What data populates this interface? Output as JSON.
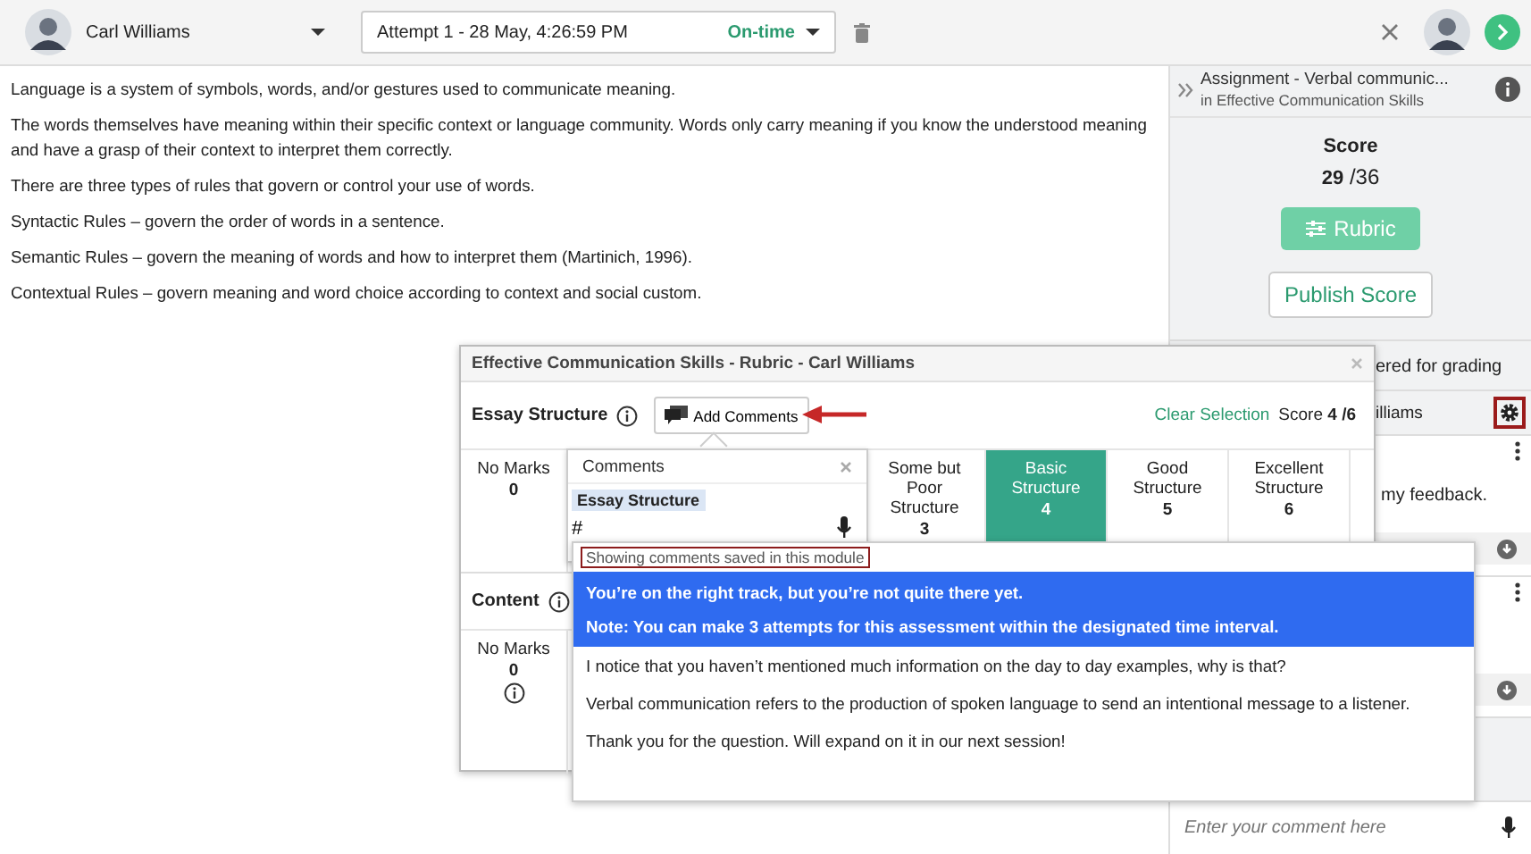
{
  "top_bar": {
    "student": "Carl Williams",
    "attempt": "Attempt 1 - 28 May, 4:26:59 PM",
    "status": "On-time"
  },
  "submission": {
    "paragraphs": [
      "Language is a system of symbols, words, and/or gestures used to communicate meaning.",
      "The words themselves have meaning within their specific context or language community. Words only carry meaning if you know the understood meaning and have a grasp of their context to interpret them correctly.",
      "There are three types of rules that govern or control your use of words.",
      "Syntactic Rules – govern the order of words in a sentence.",
      "Semantic Rules – govern the meaning of words and how to interpret them (Martinich, 1996).",
      "Contextual Rules – govern meaning and word choice according to context and social custom."
    ]
  },
  "sidebar": {
    "title": "Assignment - Verbal communic...",
    "subtitle": "in Effective Communication Skills",
    "score_label": "Score",
    "score": "**29** /36",
    "rubric_button": "Rubric",
    "publish_button": "Publish Score",
    "grading_note": "ered for grading",
    "student": "illiams",
    "comments": [
      {
        "kind": "text",
        "text": "my feedback."
      },
      {
        "kind": "covered"
      }
    ],
    "comment_placeholder": "Enter your comment here"
  },
  "rubric_dialog": {
    "title": "Effective Communication Skills - Rubric - Carl Williams",
    "criteria": [
      {
        "name": "Essay Structure",
        "add_comments": "Add Comments",
        "clear": "Clear Selection",
        "score": "Score **4 /6**",
        "levels": [
          {
            "label": "No Marks",
            "points": "0",
            "selected": false
          },
          {
            "label": "Some but Poor Structure",
            "points": "3",
            "selected": false
          },
          {
            "label": "Basic Structure",
            "points": "4",
            "selected": true
          },
          {
            "label": "Good Structure",
            "points": "5",
            "selected": false
          },
          {
            "label": "Excellent Structure",
            "points": "6",
            "selected": false
          }
        ]
      },
      {
        "name": "Content",
        "levels": [
          {
            "label": "No Marks",
            "points": "0",
            "selected": false
          }
        ]
      }
    ]
  },
  "comments_popover": {
    "title": "Comments",
    "tag": "Essay Structure",
    "value": "#"
  },
  "suggestions": {
    "header": "Showing comments saved in this module",
    "items": [
      {
        "lines": [
          "You’re on the right track, but you’re not quite there yet.",
          "Note: You can make 3 attempts for this assessment within the designated time interval."
        ],
        "selected": true
      },
      {
        "lines": [
          "I notice that you haven’t mentioned much information on the day to day examples, why is that?"
        ],
        "selected": false
      },
      {
        "lines": [
          "Verbal communication refers to the production of spoken language to send an intentional message to a listener."
        ],
        "selected": false
      },
      {
        "lines": [
          "Thank you for the question. Will expand on it in our next session!"
        ],
        "selected": false
      }
    ]
  }
}
